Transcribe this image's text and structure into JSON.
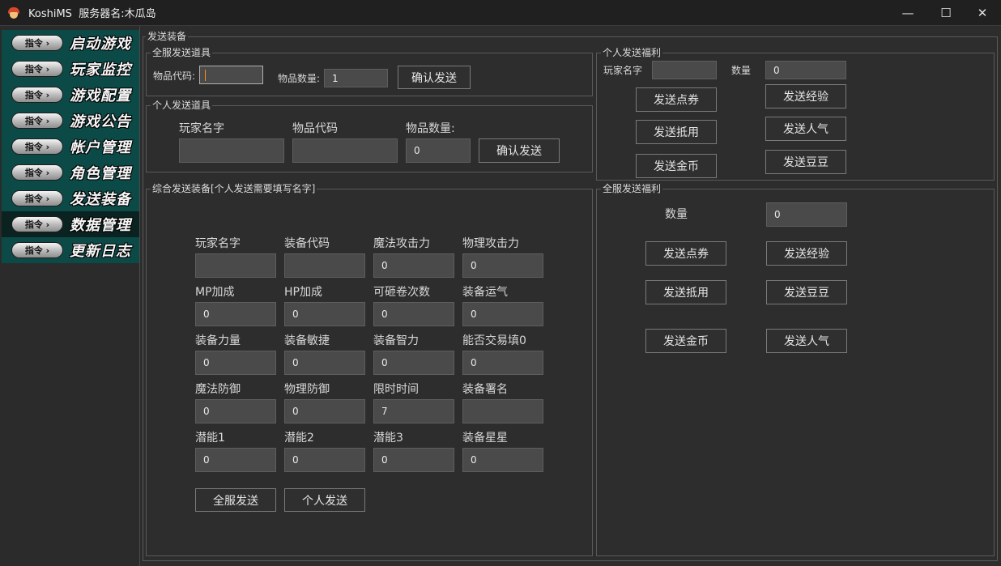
{
  "window": {
    "title": "KoshiMS  服务器名:木瓜岛",
    "controls": {
      "minimize": "—",
      "maximize": "☐",
      "close": "✕"
    }
  },
  "sidebar": {
    "button_text": "指令 ›",
    "items": [
      {
        "label": "启动游戏"
      },
      {
        "label": "玩家监控"
      },
      {
        "label": "游戏配置"
      },
      {
        "label": "游戏公告"
      },
      {
        "label": "帐户管理"
      },
      {
        "label": "角色管理"
      },
      {
        "label": "发送装备"
      },
      {
        "label": "数据管理"
      },
      {
        "label": "更新日志"
      }
    ],
    "active_index": 7
  },
  "outer_group": {
    "title": "发送装备"
  },
  "global_items": {
    "title": "全服发送道具",
    "item_code_label": "物品代码:",
    "item_code_value": "",
    "qty_label": "物品数量:",
    "qty_value": "1",
    "confirm_label": "确认发送"
  },
  "personal_items": {
    "title": "个人发送道具",
    "player_label": "玩家名字",
    "code_label": "物品代码",
    "qty_label": "物品数量:",
    "player_value": "",
    "code_value": "",
    "qty_value": "0",
    "confirm_label": "确认发送"
  },
  "equip": {
    "title": "综合发送装备[个人发送需要填写名字]",
    "fields": [
      {
        "label": "玩家名字",
        "value": ""
      },
      {
        "label": "装备代码",
        "value": ""
      },
      {
        "label": "魔法攻击力",
        "value": "0"
      },
      {
        "label": "物理攻击力",
        "value": "0"
      },
      {
        "label": "MP加成",
        "value": "0"
      },
      {
        "label": "HP加成",
        "value": "0"
      },
      {
        "label": "可砸卷次数",
        "value": "0"
      },
      {
        "label": "装备运气",
        "value": "0"
      },
      {
        "label": "装备力量",
        "value": "0"
      },
      {
        "label": "装备敏捷",
        "value": "0"
      },
      {
        "label": "装备智力",
        "value": "0"
      },
      {
        "label": "能否交易填0",
        "value": "0"
      },
      {
        "label": "魔法防御",
        "value": "0"
      },
      {
        "label": "物理防御",
        "value": "0"
      },
      {
        "label": "限时时间",
        "value": "7"
      },
      {
        "label": "装备署名",
        "value": ""
      },
      {
        "label": "潜能1",
        "value": "0"
      },
      {
        "label": "潜能2",
        "value": "0"
      },
      {
        "label": "潜能3",
        "value": "0"
      },
      {
        "label": "装备星星",
        "value": "0"
      }
    ],
    "send_all_label": "全服发送",
    "send_personal_label": "个人发送"
  },
  "personal_welfare": {
    "title": "个人发送福利",
    "player_label": "玩家名字",
    "player_value": "",
    "qty_label": "数量",
    "qty_value": "0",
    "buttons": {
      "points": "发送点券",
      "exp": "发送经验",
      "voucher": "发送抵用",
      "fame": "发送人气",
      "gold": "发送金币",
      "beans": "发送豆豆"
    }
  },
  "global_welfare": {
    "title": "全服发送福利",
    "qty_label": "数量",
    "qty_value": "0",
    "buttons": {
      "points": "发送点券",
      "exp": "发送经验",
      "voucher": "发送抵用",
      "beans": "发送豆豆",
      "gold": "发送金币",
      "fame": "发送人气"
    }
  }
}
